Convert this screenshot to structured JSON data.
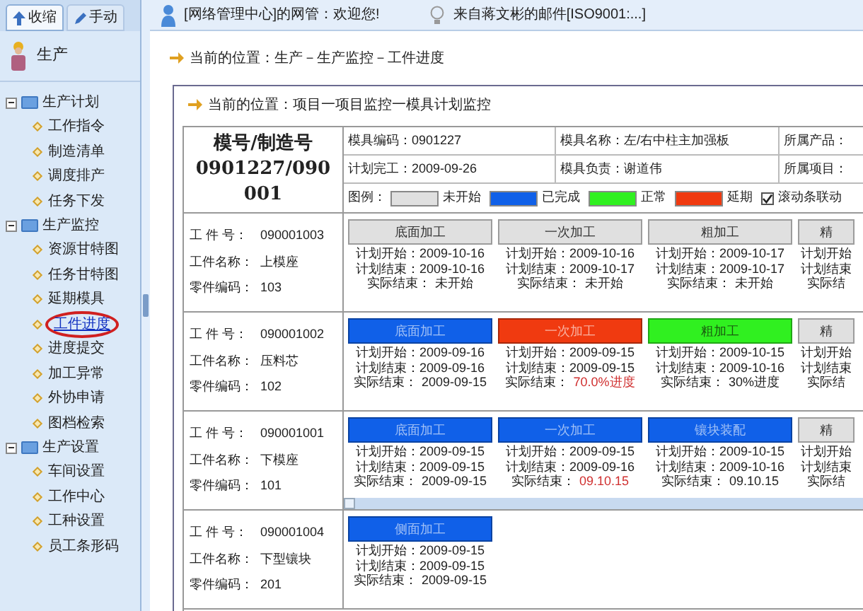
{
  "top_tabs": [
    {
      "label": "收缩",
      "selected": true
    },
    {
      "label": "手动",
      "selected": false
    }
  ],
  "top_bar": {
    "greeting": "[网络管理中心]的网管：欢迎您!",
    "mail": "来自蒋文彬的邮件[ISO9001:...]"
  },
  "sidebar": {
    "title": "生产",
    "items": [
      {
        "label": "生产计划",
        "expanded": true,
        "children": [
          {
            "label": "工作指令",
            "selected": false
          },
          {
            "label": "制造清单",
            "selected": false
          },
          {
            "label": "调度排产",
            "selected": false
          },
          {
            "label": "任务下发",
            "selected": false
          }
        ]
      },
      {
        "label": "生产监控",
        "expanded": true,
        "children": [
          {
            "label": "资源甘特图",
            "selected": false
          },
          {
            "label": "任务甘特图",
            "selected": false
          },
          {
            "label": "延期模具",
            "selected": false
          },
          {
            "label": "工件进度",
            "selected": true
          },
          {
            "label": "进度提交",
            "selected": false
          },
          {
            "label": "加工异常",
            "selected": false
          },
          {
            "label": "外协申请",
            "selected": false
          },
          {
            "label": "图档检索",
            "selected": false
          }
        ]
      },
      {
        "label": "生产设置",
        "expanded": true,
        "children": [
          {
            "label": "车间设置",
            "selected": false
          },
          {
            "label": "工作中心",
            "selected": false
          },
          {
            "label": "工种设置",
            "selected": false
          },
          {
            "label": "员工条形码",
            "selected": false
          }
        ]
      }
    ]
  },
  "breadcrumb": "当前的位置：生产－生产监控－工件进度",
  "panel": {
    "breadcrumb": "当前的位置：项目一项目监控一模具计划监控",
    "mold_title": "模号/制造号",
    "mold_number": "0901227/090001",
    "info": [
      [
        "模具编码：0901227",
        "模具名称：左/右中柱主加强板",
        "所属产品："
      ],
      [
        "计划完工：2009-09-26",
        "模具负责：谢道伟",
        "所属项目："
      ]
    ],
    "legend": {
      "label": "图例：",
      "items": [
        {
          "label": "未开始",
          "color": "#e0e0e0"
        },
        {
          "label": "已完成",
          "color": "#1060e8"
        },
        {
          "label": "正常",
          "color": "#30f020"
        },
        {
          "label": "延期",
          "color": "#f03a10"
        }
      ],
      "sync_scroll": {
        "label": "滚动条联动",
        "checked": true
      }
    },
    "parts": [
      {
        "fields": [
          [
            "工 件 号：",
            "090001003"
          ],
          [
            "工件名称：",
            "上模座"
          ],
          [
            "零件编码：",
            "103"
          ]
        ],
        "tasks": [
          {
            "name": "底面加工",
            "color": "#e0e0e0",
            "start": "计划开始：2009-10-16",
            "end": "计划结束：2009-10-16",
            "actual_label": "实际结束：",
            "actual": "未开始",
            "late": false
          },
          {
            "name": "一次加工",
            "color": "#e0e0e0",
            "start": "计划开始：2009-10-16",
            "end": "计划结束：2009-10-17",
            "actual_label": "实际结束：",
            "actual": "未开始",
            "late": false
          },
          {
            "name": "粗加工",
            "color": "#e0e0e0",
            "start": "计划开始：2009-10-17",
            "end": "计划结束：2009-10-17",
            "actual_label": "实际结束：",
            "actual": "未开始",
            "late": false
          },
          {
            "name": "精",
            "color": "#e0e0e0",
            "start": "计划开始",
            "end": "计划结束",
            "actual_label": "实际结"
          }
        ]
      },
      {
        "fields": [
          [
            "工 件 号：",
            "090001002"
          ],
          [
            "工件名称：",
            "压料芯"
          ],
          [
            "零件编码：",
            "102"
          ]
        ],
        "tasks": [
          {
            "name": "底面加工",
            "color": "#1060e8",
            "start": "计划开始：2009-09-16",
            "end": "计划结束：2009-09-16",
            "actual_label": "实际结束：",
            "actual": "2009-09-15",
            "late": false
          },
          {
            "name": "一次加工",
            "color": "#f03a10",
            "start": "计划开始：2009-09-15",
            "end": "计划结束：2009-09-15",
            "actual_label": "实际结束：",
            "actual": "70.0%进度",
            "late": true
          },
          {
            "name": "粗加工",
            "color": "#30f020",
            "start": "计划开始：2009-10-15",
            "end": "计划结束：2009-10-16",
            "actual_label": "实际结束：",
            "actual": "30%进度",
            "late": false
          },
          {
            "name": "精",
            "color": "#e0e0e0",
            "start": "计划开始",
            "end": "计划结束",
            "actual_label": "实际结"
          }
        ]
      },
      {
        "fields": [
          [
            "工 件 号：",
            "090001001"
          ],
          [
            "工件名称：",
            "下模座"
          ],
          [
            "零件编码：",
            "101"
          ]
        ],
        "scrollbar": true,
        "tasks": [
          {
            "name": "底面加工",
            "color": "#1060e8",
            "start": "计划开始：2009-09-15",
            "end": "计划结束：2009-09-15",
            "actual_label": "实际结束：",
            "actual": "2009-09-15",
            "late": false
          },
          {
            "name": "一次加工",
            "color": "#1060e8",
            "start": "计划开始：2009-09-15",
            "end": "计划结束：2009-09-16",
            "actual_label": "实际结束：",
            "actual": "09.10.15",
            "late": true
          },
          {
            "name": "镶块装配",
            "color": "#1060e8",
            "start": "计划开始：2009-10-15",
            "end": "计划结束：2009-10-16",
            "actual_label": "实际结束：",
            "actual": "09.10.15",
            "late": false
          },
          {
            "name": "精",
            "color": "#e0e0e0",
            "start": "计划开始",
            "end": "计划结束",
            "actual_label": "实际结"
          }
        ]
      },
      {
        "fields": [
          [
            "工 件 号：",
            "090001004"
          ],
          [
            "工件名称：",
            "下型镶块"
          ],
          [
            "零件编码：",
            "201"
          ]
        ],
        "tasks": [
          {
            "name": "侧面加工",
            "color": "#1060e8",
            "start": "计划开始：2009-09-15",
            "end": "计划结束：2009-09-15",
            "actual_label": "实际结束：",
            "actual": "2009-09-15",
            "late": false
          }
        ]
      }
    ]
  }
}
